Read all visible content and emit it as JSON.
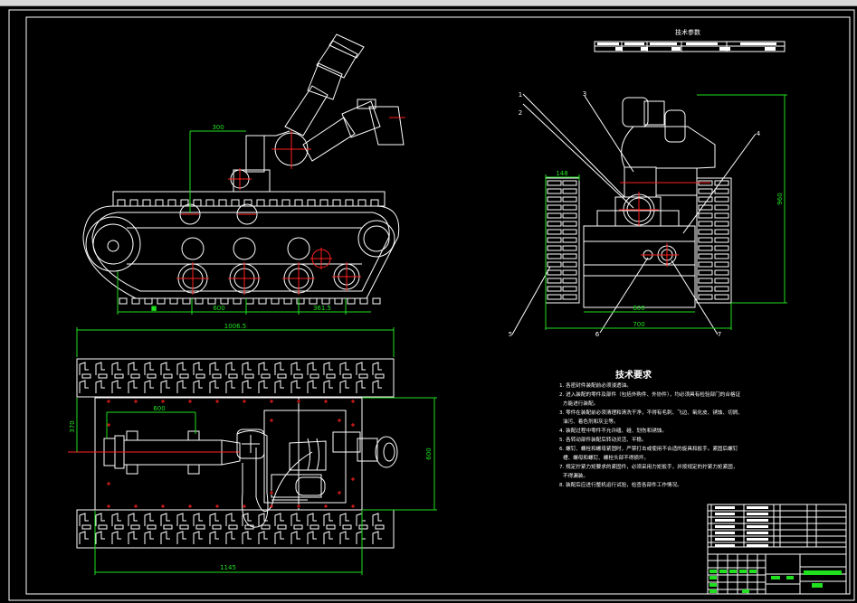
{
  "drawing": {
    "parameter_table_title": "技术参数",
    "requirements_title": "技术要求",
    "requirements": [
      "1. 各密封件装配前必须浸透油。",
      "2. 进入装配的零件及部件（包括外购件、外协件），均必须具有检验部门的合格证",
      "方能进行装配。",
      "3. 零件在装配前必须清理和清洗干净，不得有毛刺、飞边、氧化皮、锈蚀、切屑、",
      "油污、着色剂和灰尘等。",
      "4. 装配过程中零件不允许磕、碰、划伤和锈蚀。",
      "5. 各转动部件装配后转动灵活、平稳。",
      "6. 螺钉、螺栓和螺母紧固时，严禁打击或使用不合适的旋具和扳手。紧固后螺钉",
      "槽、螺母和螺钉、螺栓头部不得损坏。",
      "7. 规定拧紧力矩要求的紧固件，必须采用力矩扳手，并按规定的拧紧力矩紧固，",
      "不得漏装。",
      "8. 装配后应进行整机运行试验，检查各部件工作情况。"
    ],
    "dimensions": {
      "side_top": "300",
      "side_a": "■",
      "side_b": "600",
      "side_c": "361.5",
      "side_overall": "1006.5",
      "top_width": "370",
      "top_span": "600",
      "top_height": "600",
      "top_overall": "1145",
      "front_track": "148",
      "front_height": "960",
      "front_inner": "600",
      "front_overall": "700"
    },
    "leaders": [
      "1",
      "2",
      "3",
      "4",
      "5",
      "6",
      "7"
    ],
    "colors": {
      "background": "#000000",
      "lines": "#ffffff",
      "dimensions": "#20e020",
      "centerlines": "#ff2020"
    }
  }
}
